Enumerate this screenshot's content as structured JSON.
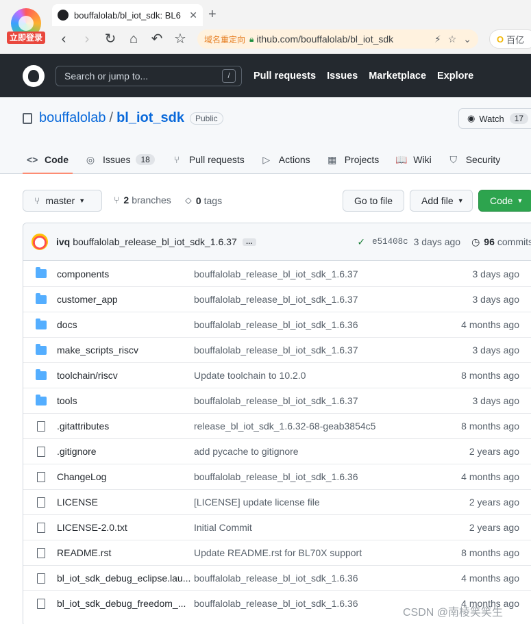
{
  "browser": {
    "badge": "立即登录",
    "tab_title": "bouffalolab/bl_iot_sdk: BL6",
    "tab_close": "✕",
    "new_tab": "+",
    "redirect_label": "域名重定向",
    "url": "ithub.com/bouffalolab/bl_iot_sdk",
    "search_partial": "百亿"
  },
  "github": {
    "search_placeholder": "Search or jump to...",
    "search_shortcut": "/",
    "nav": [
      "Pull requests",
      "Issues",
      "Marketplace",
      "Explore"
    ]
  },
  "repo": {
    "owner": "bouffalolab",
    "separator": "/",
    "name": "bl_iot_sdk",
    "visibility": "Public",
    "watch_label": "Watch",
    "watch_count": "17",
    "tabs": [
      {
        "label": "Code",
        "icon": "code-icon",
        "glyph": "<>"
      },
      {
        "label": "Issues",
        "icon": "issue-icon",
        "glyph": "◎",
        "count": "18"
      },
      {
        "label": "Pull requests",
        "icon": "pull-request-icon",
        "glyph": "⑂"
      },
      {
        "label": "Actions",
        "icon": "play-icon",
        "glyph": "▷"
      },
      {
        "label": "Projects",
        "icon": "table-icon",
        "glyph": "▦"
      },
      {
        "label": "Wiki",
        "icon": "book-icon",
        "glyph": "📖"
      },
      {
        "label": "Security",
        "icon": "shield-icon",
        "glyph": "⛉"
      }
    ]
  },
  "toolbar": {
    "branch": "master",
    "branches_count": "2",
    "branches_label": "branches",
    "tags_count": "0",
    "tags_label": "tags",
    "go_to_file": "Go to file",
    "add_file": "Add file",
    "code": "Code"
  },
  "commit": {
    "author": "ivq",
    "message": "bouffalolab_release_bl_iot_sdk_1.6.37",
    "more": "…",
    "sha": "e51408c",
    "when": "3 days ago",
    "commits_count": "96",
    "commits_label": "commits"
  },
  "files": [
    {
      "name": "components",
      "type": "dir",
      "message": "bouffalolab_release_bl_iot_sdk_1.6.37",
      "age": "3 days ago"
    },
    {
      "name": "customer_app",
      "type": "dir",
      "message": "bouffalolab_release_bl_iot_sdk_1.6.37",
      "age": "3 days ago"
    },
    {
      "name": "docs",
      "type": "dir",
      "message": "bouffalolab_release_bl_iot_sdk_1.6.36",
      "age": "4 months ago"
    },
    {
      "name": "make_scripts_riscv",
      "type": "dir",
      "message": "bouffalolab_release_bl_iot_sdk_1.6.37",
      "age": "3 days ago"
    },
    {
      "name": "toolchain/riscv",
      "type": "dir",
      "message": "Update toolchain to 10.2.0",
      "age": "8 months ago"
    },
    {
      "name": "tools",
      "type": "dir",
      "message": "bouffalolab_release_bl_iot_sdk_1.6.37",
      "age": "3 days ago"
    },
    {
      "name": ".gitattributes",
      "type": "file",
      "message": "release_bl_iot_sdk_1.6.32-68-geab3854c5",
      "age": "8 months ago"
    },
    {
      "name": ".gitignore",
      "type": "file",
      "message": "add pycache to gitignore",
      "age": "2 years ago"
    },
    {
      "name": "ChangeLog",
      "type": "file",
      "message": "bouffalolab_release_bl_iot_sdk_1.6.36",
      "age": "4 months ago"
    },
    {
      "name": "LICENSE",
      "type": "file",
      "message": "[LICENSE] update license file",
      "age": "2 years ago"
    },
    {
      "name": "LICENSE-2.0.txt",
      "type": "file",
      "message": "Initial Commit",
      "age": "2 years ago"
    },
    {
      "name": "README.rst",
      "type": "file",
      "message": "Update README.rst for BL70X support",
      "age": "8 months ago"
    },
    {
      "name": "bl_iot_sdk_debug_eclipse.lau...",
      "type": "file",
      "message": "bouffalolab_release_bl_iot_sdk_1.6.36",
      "age": "4 months ago"
    },
    {
      "name": "bl_iot_sdk_debug_freedom_...",
      "type": "file",
      "message": "bouffalolab_release_bl_iot_sdk_1.6.36",
      "age": "4 months ago"
    }
  ],
  "watermark": "CSDN @南棱笑笑生",
  "colors": {
    "accent": "#0969da",
    "header_bg": "#24292f",
    "code_button": "#2da44e",
    "active_tab_underline": "#fd8c73",
    "folder": "#54aeff"
  }
}
